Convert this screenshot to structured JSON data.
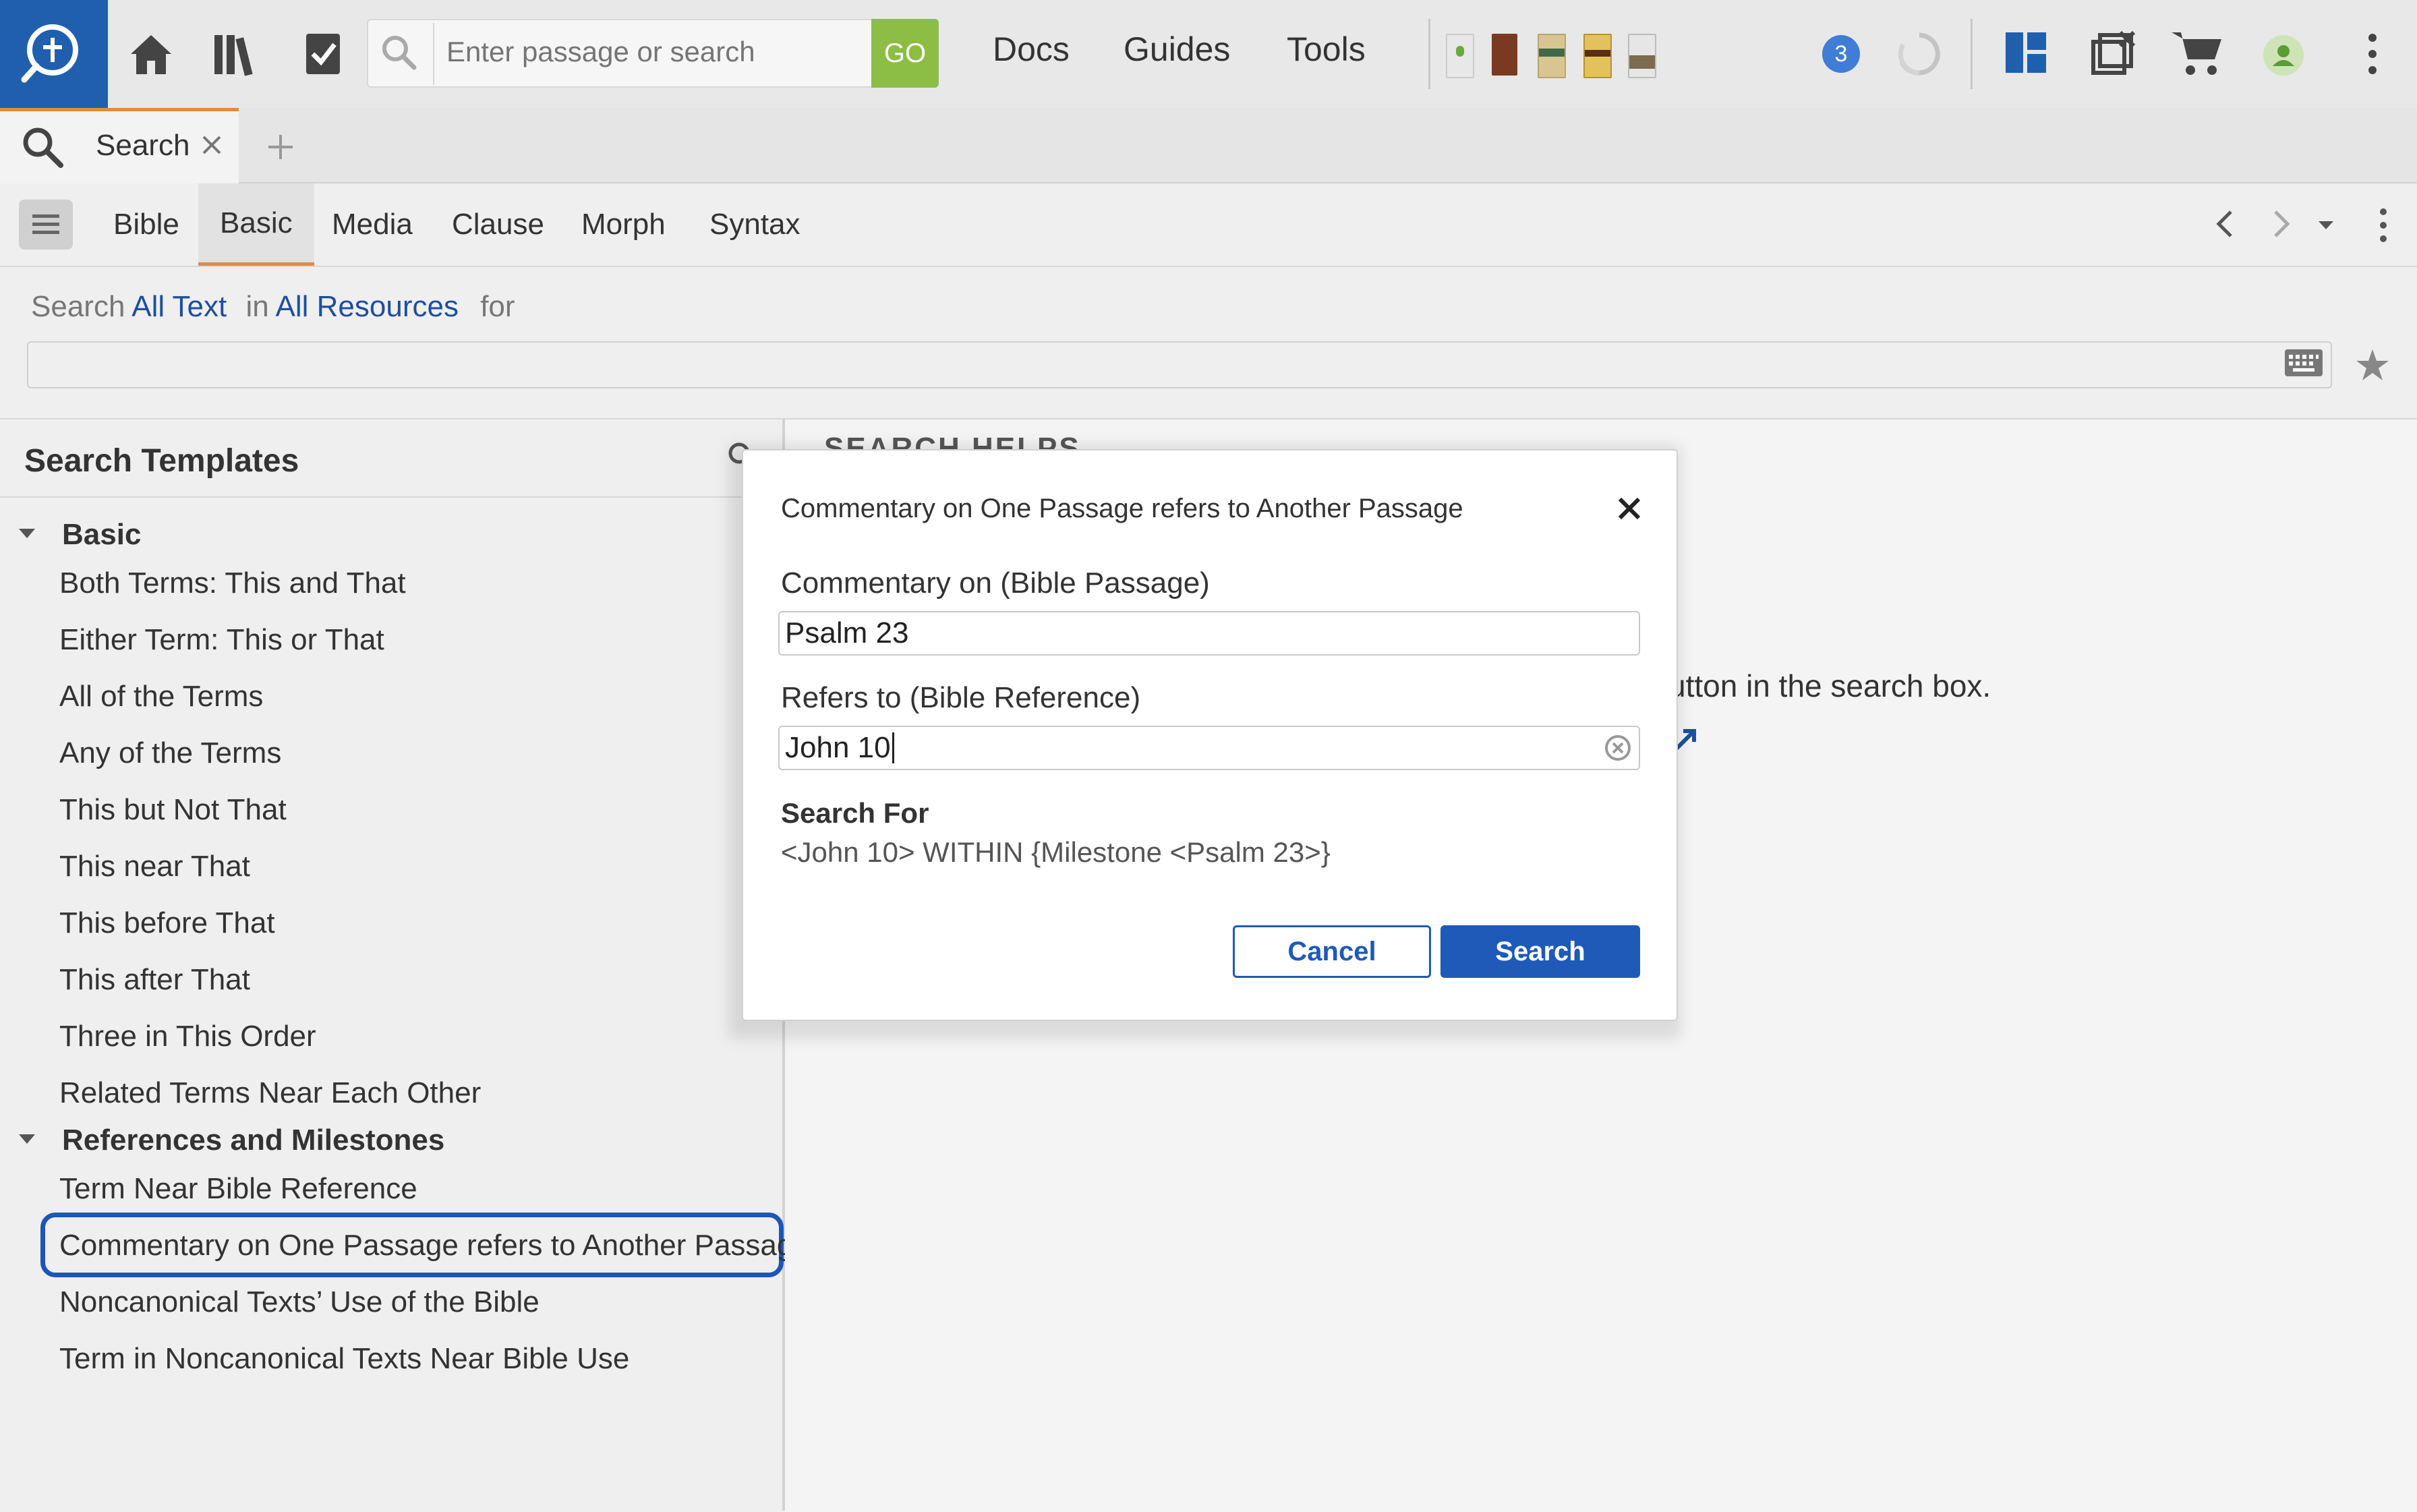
{
  "toolbar": {
    "search_placeholder": "Enter passage or search",
    "go_label": "GO",
    "menus": [
      "Docs",
      "Guides",
      "Tools"
    ],
    "notification_count": "3"
  },
  "tabs": [
    {
      "label": "Search"
    }
  ],
  "subtabs": [
    "Bible",
    "Basic",
    "Media",
    "Clause",
    "Morph",
    "Syntax"
  ],
  "active_subtab": "Basic",
  "search_header": {
    "prefix": "Search",
    "scope": "All Text",
    "in_label": "in",
    "resources": "All Resources",
    "for_label": "for"
  },
  "left_panel": {
    "title": "Search Templates",
    "groups": [
      {
        "label": "Basic",
        "items": [
          "Both Terms: This and That",
          "Either Term: This or That",
          "All of the Terms",
          "Any of the Terms",
          "This but Not That",
          "This near That",
          "This before That",
          "This after That",
          "Three in This Order",
          "Related Terms Near Each Other"
        ]
      },
      {
        "label": "References and Milestones",
        "items": [
          "Term Near Bible Reference",
          "Commentary on One Passage refers to Another Passage",
          "Noncanonical Texts’ Use of the Bible",
          "Term in Noncanonical Texts Near Bible Use"
        ]
      }
    ]
  },
  "right_panel": {
    "partial_heading": "SEARCH HELPS",
    "partial_text": "utton in the search box."
  },
  "dialog": {
    "title": "Commentary on One Passage refers to Another Passage",
    "field1_label": "Commentary on (Bible Passage)",
    "field1_value": "Psalm 23",
    "field2_label": "Refers to (Bible Reference)",
    "field2_value": "John 10",
    "search_for_label": "Search For",
    "search_for_value": "<John 10> WITHIN {Milestone <Psalm 23>}",
    "cancel_label": "Cancel",
    "search_label": "Search"
  },
  "colors": {
    "brand_blue": "#1f5fae",
    "accent_orange": "#e48a3b",
    "go_green": "#8cbd45",
    "link_blue": "#1f4f9c",
    "primary_button": "#1f5ab8"
  }
}
